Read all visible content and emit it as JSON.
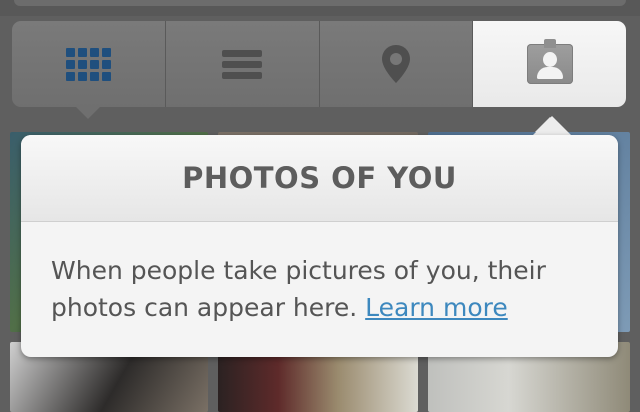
{
  "tabs": [
    {
      "id": "grid",
      "icon": "grid-icon",
      "active": false
    },
    {
      "id": "list",
      "icon": "list-icon",
      "active": false
    },
    {
      "id": "map",
      "icon": "map-pin-icon",
      "active": false
    },
    {
      "id": "photos-of-you",
      "icon": "photos-of-you-icon",
      "active": true
    }
  ],
  "popup": {
    "title": "PHOTOS OF YOU",
    "message": "When people take pictures of you, their photos can appear here.",
    "learn_more": "Learn more"
  },
  "colors": {
    "grid_icon": "#1f4f7e",
    "link": "#3d88be",
    "text": "#555555"
  }
}
